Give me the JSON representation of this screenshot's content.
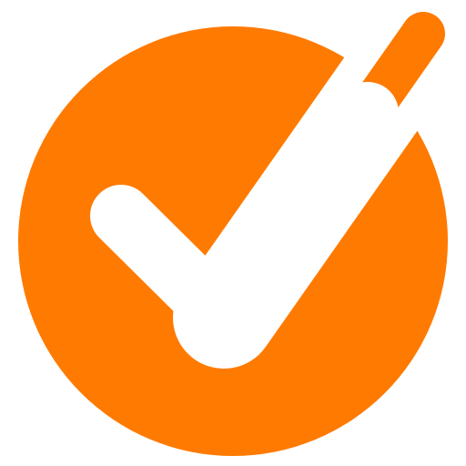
{
  "icon": {
    "name": "check-circle-icon",
    "colors": {
      "circle": "#FF7A00",
      "check": "#FFFFFF",
      "background": "#FFFFFF"
    }
  }
}
